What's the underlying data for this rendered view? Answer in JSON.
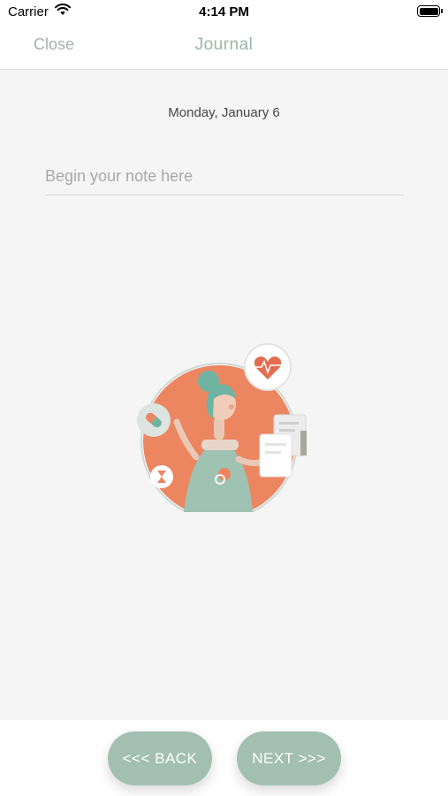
{
  "status_bar": {
    "carrier": "Carrier",
    "time": "4:14 PM"
  },
  "nav": {
    "close_label": "Close",
    "title": "Journal"
  },
  "main": {
    "date": "Monday, January 6",
    "note_placeholder": "Begin your note here",
    "note_value": ""
  },
  "footer": {
    "back_label": "<<< BACK",
    "next_label": "NEXT >>>"
  },
  "colors": {
    "accent": "#98b7a8",
    "button": "#a2bfb1",
    "illustration_orange": "#ec8660",
    "illustration_teal": "#6fb3a3"
  }
}
